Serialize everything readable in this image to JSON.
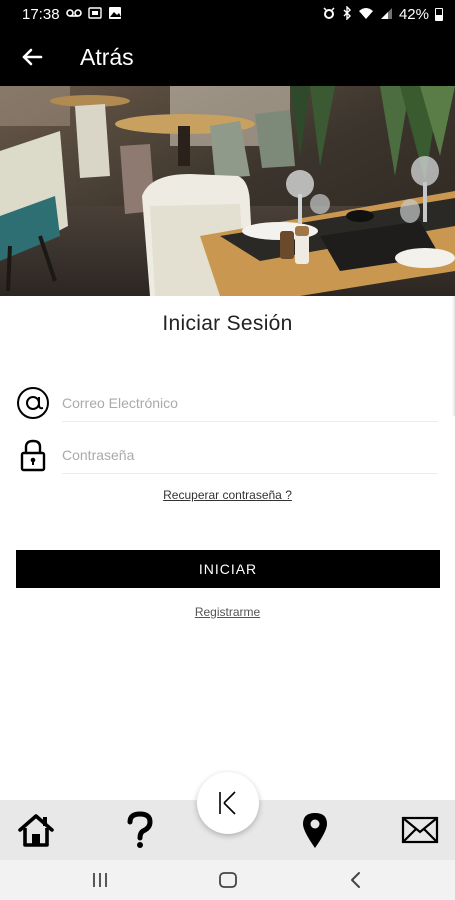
{
  "status_bar": {
    "time": "17:38",
    "battery": "42%"
  },
  "app_bar": {
    "title": "Atrás"
  },
  "login": {
    "title": "Iniciar Sesión",
    "email_placeholder": "Correo Electrónico",
    "password_placeholder": "Contraseña",
    "recover_link": "Recuperar contraseña ?",
    "start_button": "INICIAR",
    "register_link": "Registrarme"
  },
  "tab_bar": {
    "items": [
      {
        "icon": "home-icon"
      },
      {
        "icon": "help-icon"
      },
      {
        "icon": "logo-k-icon"
      },
      {
        "icon": "location-pin-icon"
      },
      {
        "icon": "mail-icon"
      }
    ]
  },
  "nav_bar": {
    "items": [
      {
        "icon": "recent-apps-icon"
      },
      {
        "icon": "home-nav-icon"
      },
      {
        "icon": "back-nav-icon"
      }
    ]
  },
  "colors": {
    "app_bar": "#000000",
    "button": "#000000",
    "tab_bar": "#e8e8e8"
  }
}
